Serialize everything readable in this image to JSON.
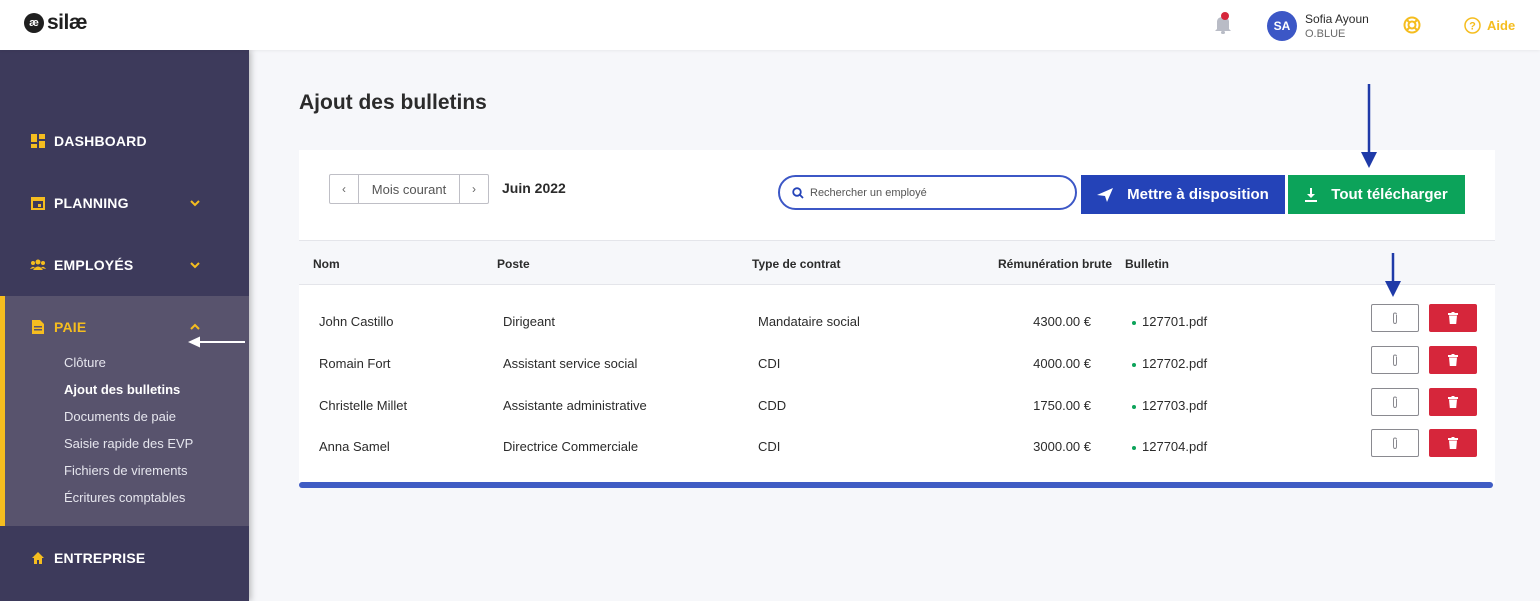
{
  "header": {
    "logo_mark": "æ",
    "logo_text": "silæ",
    "user_initials": "SA",
    "user_name": "Sofia Ayoun",
    "user_org": "O.BLUE",
    "help_label": "Aide"
  },
  "sidebar": {
    "items": [
      {
        "label": "DASHBOARD",
        "icon": "dashboard-icon"
      },
      {
        "label": "PLANNING",
        "icon": "calendar-icon"
      },
      {
        "label": "EMPLOYÉS",
        "icon": "users-icon"
      },
      {
        "label": "PAIE",
        "icon": "document-icon"
      },
      {
        "label": "ENTREPRISE",
        "icon": "home-icon"
      }
    ],
    "paie_subitems": [
      {
        "label": "Clôture"
      },
      {
        "label": "Ajout des bulletins",
        "active": true
      },
      {
        "label": "Documents de paie"
      },
      {
        "label": "Saisie rapide des EVP"
      },
      {
        "label": "Fichiers de virements"
      },
      {
        "label": "Écritures comptables"
      }
    ]
  },
  "main": {
    "title": "Ajout des bulletins",
    "month_nav": {
      "prev": "‹",
      "current": "Mois courant",
      "next": "›"
    },
    "month_label": "Juin 2022",
    "search": {
      "placeholder": "Rechercher un employé"
    },
    "publish_button": "Mettre à disposition",
    "download_all_button": "Tout télécharger",
    "table": {
      "headers": [
        "Nom",
        "Poste",
        "Type de contrat",
        "Rémunération brute",
        "Bulletin"
      ],
      "rows": [
        {
          "name": "John Castillo",
          "poste": "Dirigeant",
          "contrat": "Mandataire social",
          "remuneration": "4300.00 €",
          "bulletin": "127701.pdf"
        },
        {
          "name": "Romain Fort",
          "poste": "Assistant service social",
          "contrat": "CDI",
          "remuneration": "4000.00 €",
          "bulletin": "127702.pdf"
        },
        {
          "name": "Christelle Millet",
          "poste": "Assistante administrative",
          "contrat": "CDD",
          "remuneration": "1750.00 €",
          "bulletin": "127703.pdf"
        },
        {
          "name": "Anna Samel",
          "poste": "Directrice Commerciale",
          "contrat": "CDI",
          "remuneration": "3000.00 €",
          "bulletin": "127704.pdf"
        }
      ]
    }
  },
  "colors": {
    "sidebar_bg": "#3d3a5b",
    "accent_yellow": "#f5bd1f",
    "primary_blue": "#2443b8",
    "success_green": "#0ca35a",
    "danger_red": "#d6263b"
  }
}
